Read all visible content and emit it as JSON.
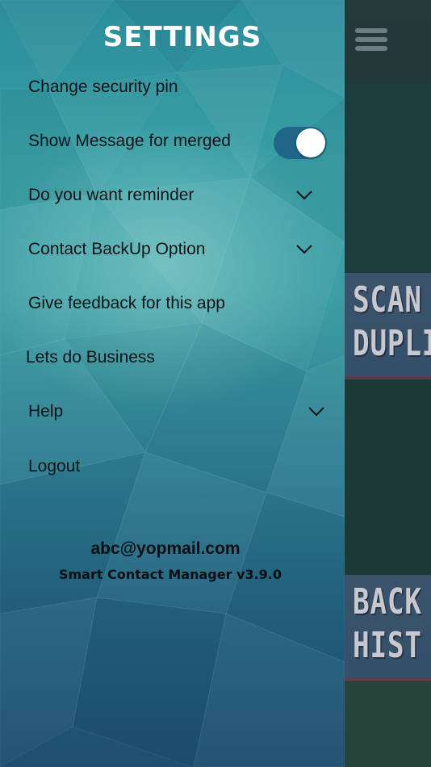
{
  "drawer": {
    "title": "SETTINGS",
    "items": [
      {
        "label": "Change security pin"
      },
      {
        "label": "Show Message for merged",
        "toggle": "on"
      },
      {
        "label": "Do you want reminder",
        "expandable": true
      },
      {
        "label": "Contact BackUp Option",
        "expandable": true
      },
      {
        "label": "Give feedback for this app"
      },
      {
        "label": "Lets do Business"
      },
      {
        "label": "Help",
        "expandable": true
      },
      {
        "label": "Logout"
      }
    ],
    "account_email": "abc@yopmail.com",
    "app_version": "Smart Contact Manager v3.9.0"
  },
  "background_app": {
    "tiles": [
      {
        "line1": "SCAN",
        "line2": "DUPLI"
      },
      {
        "line1": "BACK",
        "line2": "HIST"
      }
    ],
    "menu_icon": "hamburger-icon"
  },
  "colors": {
    "toggle_track": "#1f6688",
    "drawer_top": "#2b8d9a",
    "drawer_bottom": "#1e4f6f",
    "tile": "#3b536b"
  }
}
